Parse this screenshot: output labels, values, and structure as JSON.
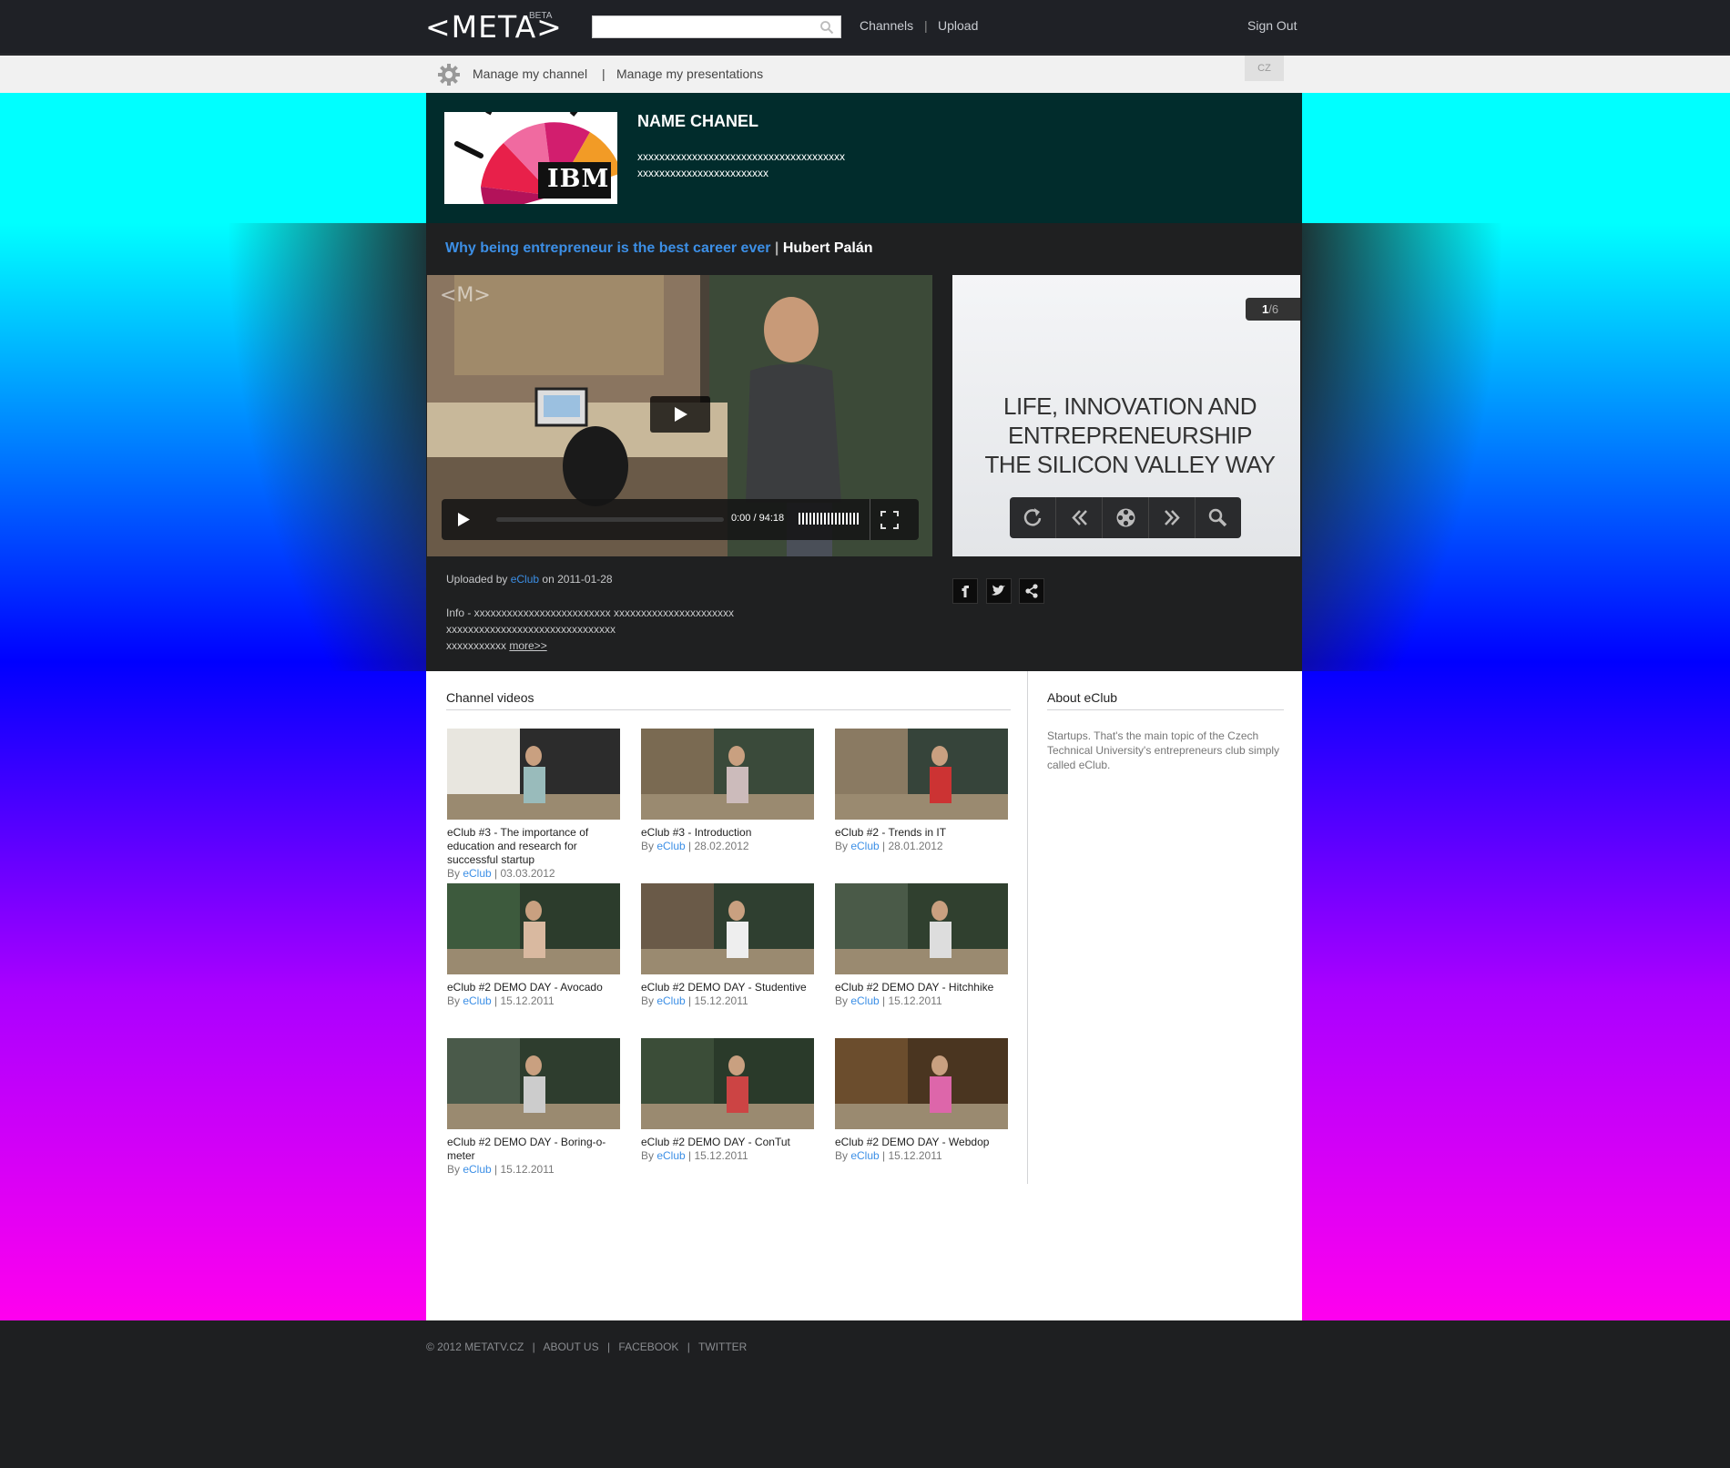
{
  "header": {
    "logo": "<META>",
    "beta": "BETA",
    "search_placeholder": "",
    "nav": [
      "Channels",
      "|",
      "Upload"
    ],
    "signout": "Sign Out"
  },
  "subbar": {
    "manage_channel": "Manage my channel",
    "sep": "|",
    "manage_presentations": "Manage my presentations",
    "lang": "CZ"
  },
  "channel": {
    "name": "NAME CHANEL",
    "desc_line1": "xxxxxxxxxxxxxxxxxxxxxxxxxxxxxxxxxxxxxx",
    "desc_line2": "xxxxxxxxxxxxxxxxxxxxxxxx",
    "logo_text": "IBM"
  },
  "presentation": {
    "title": "Why being entrepreneur is the best career ever",
    "sep": " | ",
    "author": "Hubert Palán",
    "video_watermark": "<M>",
    "video_time": "0:00 / 94:18",
    "slide_counter_current": "1",
    "slide_counter_total": "/6",
    "slide_text": "LIFE, INNOVATION AND ENTREPRENEURSHIP THE SILICON VALLEY WAY",
    "uploaded_prefix": "Uploaded by ",
    "uploaded_by": "eClub",
    "uploaded_suffix": " on 2011-01-28",
    "info_line1": "Info - xxxxxxxxxxxxxxxxxxxxxxxxx xxxxxxxxxxxxxxxxxxxxxx",
    "info_line2": "xxxxxxxxxxxxxxxxxxxxxxxxxxxxxxx",
    "info_line3": "xxxxxxxxxxx ",
    "more": "more>>"
  },
  "channel_videos": {
    "title": "Channel videos",
    "items": [
      {
        "title": "eClub #3 - The importance of education and research for successful startup",
        "by": "By ",
        "author": "eClub",
        "date": " | 03.03.2012"
      },
      {
        "title": "eClub #3 - Introduction",
        "by": "By ",
        "author": "eClub",
        "date": " | 28.02.2012"
      },
      {
        "title": "eClub #2 - Trends in IT",
        "by": "By ",
        "author": "eClub",
        "date": " | 28.01.2012"
      },
      {
        "title": "eClub #2 DEMO DAY - Avocado",
        "by": "By ",
        "author": "eClub",
        "date": " | 15.12.2011"
      },
      {
        "title": "eClub #2 DEMO DAY - Studentive",
        "by": "By ",
        "author": "eClub",
        "date": " | 15.12.2011"
      },
      {
        "title": "eClub #2 DEMO DAY - Hitchhike",
        "by": "By ",
        "author": "eClub",
        "date": " | 15.12.2011"
      },
      {
        "title": "eClub #2 DEMO DAY - Boring-o-meter",
        "by": "By ",
        "author": "eClub",
        "date": " | 15.12.2011"
      },
      {
        "title": "eClub #2 DEMO DAY - ConTut",
        "by": "By ",
        "author": "eClub",
        "date": " | 15.12.2011"
      },
      {
        "title": "eClub #2 DEMO DAY - Webdop",
        "by": "By ",
        "author": "eClub",
        "date": " | 15.12.2011"
      }
    ]
  },
  "about": {
    "title": "About eClub",
    "text": "Startups. That's the main topic of the Czech Technical University's entrepreneurs club simply called eClub."
  },
  "footer": {
    "copyright": "© 2012 METATV.CZ",
    "about": "ABOUT US",
    "facebook": "FACEBOOK",
    "twitter": "TWITTER",
    "sep": "|"
  },
  "colors": {
    "link_blue": "#3c8fe6",
    "header_bg": "#1f2126",
    "channel_band": "#00ffff",
    "channel_inner": "#012c2c"
  }
}
